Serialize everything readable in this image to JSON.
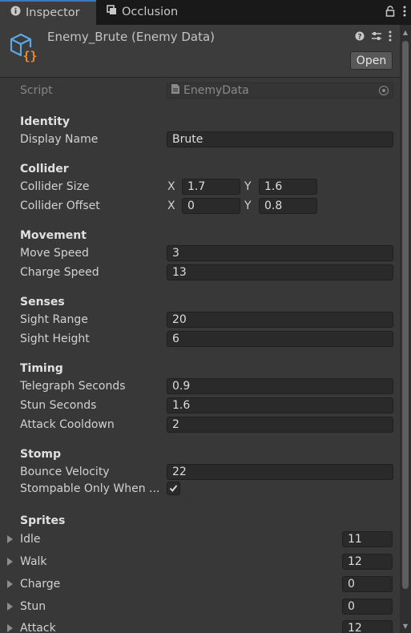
{
  "tabs": {
    "inspector": "Inspector",
    "occlusion": "Occlusion"
  },
  "header": {
    "title": "Enemy_Brute (Enemy Data)",
    "open_button": "Open"
  },
  "script": {
    "label": "Script",
    "value": "EnemyData"
  },
  "identity": {
    "heading": "Identity",
    "display_name_label": "Display Name",
    "display_name": "Brute"
  },
  "collider": {
    "heading": "Collider",
    "size_label": "Collider Size",
    "size_x": "1.7",
    "size_y": "1.6",
    "offset_label": "Collider Offset",
    "offset_x": "0",
    "offset_y": "0.8",
    "x_axis": "X",
    "y_axis": "Y"
  },
  "movement": {
    "heading": "Movement",
    "move_speed_label": "Move Speed",
    "move_speed": "3",
    "charge_speed_label": "Charge Speed",
    "charge_speed": "13"
  },
  "senses": {
    "heading": "Senses",
    "sight_range_label": "Sight Range",
    "sight_range": "20",
    "sight_height_label": "Sight Height",
    "sight_height": "6"
  },
  "timing": {
    "heading": "Timing",
    "telegraph_label": "Telegraph Seconds",
    "telegraph": "0.9",
    "stun_label": "Stun Seconds",
    "stun": "1.6",
    "cooldown_label": "Attack Cooldown",
    "cooldown": "2"
  },
  "stomp": {
    "heading": "Stomp",
    "bounce_label": "Bounce Velocity",
    "bounce": "22",
    "stompable_label": "Stompable Only When ...",
    "stompable_checked": true
  },
  "sprites": {
    "heading": "Sprites",
    "items": [
      {
        "label": "Idle",
        "count": "11"
      },
      {
        "label": "Walk",
        "count": "12"
      },
      {
        "label": "Charge",
        "count": "0"
      },
      {
        "label": "Stun",
        "count": "0"
      },
      {
        "label": "Attack",
        "count": "12"
      }
    ]
  },
  "colors": {
    "accent": "#3a79bb",
    "icon_blue": "#5aa8e6",
    "icon_orange": "#f08a24"
  }
}
